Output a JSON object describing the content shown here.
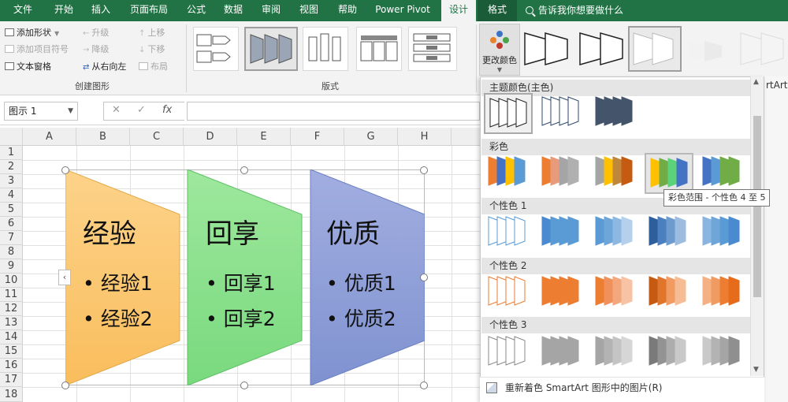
{
  "tabs": [
    "文件",
    "开始",
    "插入",
    "页面布局",
    "公式",
    "数据",
    "审阅",
    "视图",
    "帮助",
    "Power Pivot",
    "设计",
    "格式"
  ],
  "tell_me": "告诉我你想要做什么",
  "create_graphic": {
    "add_shape": "添加形状",
    "add_bullet": "添加项目符号",
    "text_pane": "文本窗格",
    "promote": "升级",
    "demote": "降级",
    "right_to_left": "从右向左",
    "move_up": "上移",
    "move_down": "下移",
    "layout": "布局",
    "group_label": "创建图形"
  },
  "layouts_label": "版式",
  "change_colors": "更改颜色",
  "partial_text": "rtArt",
  "name_box": "图示 1",
  "formula_buttons": {
    "cancel": "✕",
    "enter": "✓",
    "fx": "fx"
  },
  "columns": [
    "A",
    "B",
    "C",
    "D",
    "E",
    "F",
    "G",
    "H"
  ],
  "rows": [
    "1",
    "2",
    "3",
    "4",
    "5",
    "6",
    "7",
    "8",
    "9",
    "10",
    "11",
    "12",
    "13",
    "14",
    "15",
    "16",
    "17",
    "18"
  ],
  "smartart": [
    {
      "title": "经验",
      "bullets": [
        "经验1",
        "经验2"
      ],
      "color": "#fbc766"
    },
    {
      "title": "回享",
      "bullets": [
        "回享1",
        "回享2"
      ],
      "color": "#88e08a"
    },
    {
      "title": "优质",
      "bullets": [
        "优质1",
        "优质2"
      ],
      "color": "#8a9bd6"
    }
  ],
  "color_panel": {
    "sections": [
      "主题颜色(主色)",
      "彩色",
      "个性色 1",
      "个性色 2",
      "个性色 3"
    ],
    "tooltip": "彩色范围 - 个性色 4 至 5",
    "footer": "重新着色 SmartArt 图形中的图片(R)"
  }
}
